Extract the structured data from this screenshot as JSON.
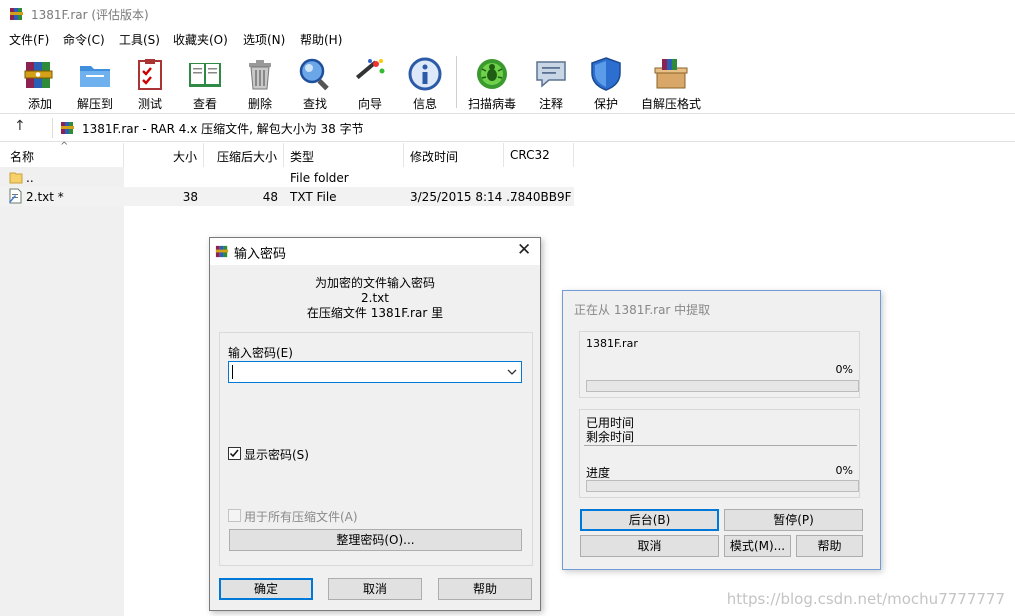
{
  "window": {
    "title": "1381F.rar (评估版本)"
  },
  "menu": [
    "文件(F)",
    "命令(C)",
    "工具(S)",
    "收藏夹(O)",
    "选项(N)",
    "帮助(H)"
  ],
  "toolbar": {
    "add": "添加",
    "extract": "解压到",
    "test": "测试",
    "view": "查看",
    "delete": "删除",
    "find": "查找",
    "wizard": "向导",
    "info": "信息",
    "scan": "扫描病毒",
    "comment": "注释",
    "protect": "保护",
    "sfx": "自解压格式"
  },
  "address": {
    "up": "↑",
    "text": "1381F.rar - RAR 4.x 压缩文件, 解包大小为 38 字节"
  },
  "columns": {
    "name": "名称",
    "size": "大小",
    "packed": "压缩后大小",
    "type": "类型",
    "modified": "修改时间",
    "crc": "CRC32"
  },
  "rows": [
    {
      "name": "..",
      "size": "",
      "packed": "",
      "type": "File folder",
      "modified": "",
      "crc": ""
    },
    {
      "name": "2.txt *",
      "size": "38",
      "packed": "48",
      "type": "TXT File",
      "modified": "3/25/2015 8:14 ...",
      "crc": "7840BB9F"
    }
  ],
  "password_dialog": {
    "title": "输入密码",
    "line1": "为加密的文件输入密码",
    "line2": "2.txt",
    "line3": "在压缩文件 1381F.rar 里",
    "field_label": "输入密码(E)",
    "field_value": "",
    "show_password": "显示密码(S)",
    "show_password_checked": true,
    "use_all": "用于所有压缩文件(A)",
    "use_all_checked": false,
    "organize": "整理密码(O)...",
    "ok": "确定",
    "cancel": "取消",
    "help": "帮助"
  },
  "extract_dialog": {
    "title": "正在从 1381F.rar 中提取",
    "archive": "1381F.rar",
    "percent_file": "0%",
    "progress_file": 0,
    "elapsed": "已用时间",
    "remaining": "剩余时间",
    "progress_label": "进度",
    "percent_total": "0%",
    "progress_total": 0,
    "background": "后台(B)",
    "pause": "暂停(P)",
    "cancel": "取消",
    "mode": "模式(M)...",
    "help": "帮助"
  },
  "watermark": "https://blog.csdn.net/mochu7777777"
}
